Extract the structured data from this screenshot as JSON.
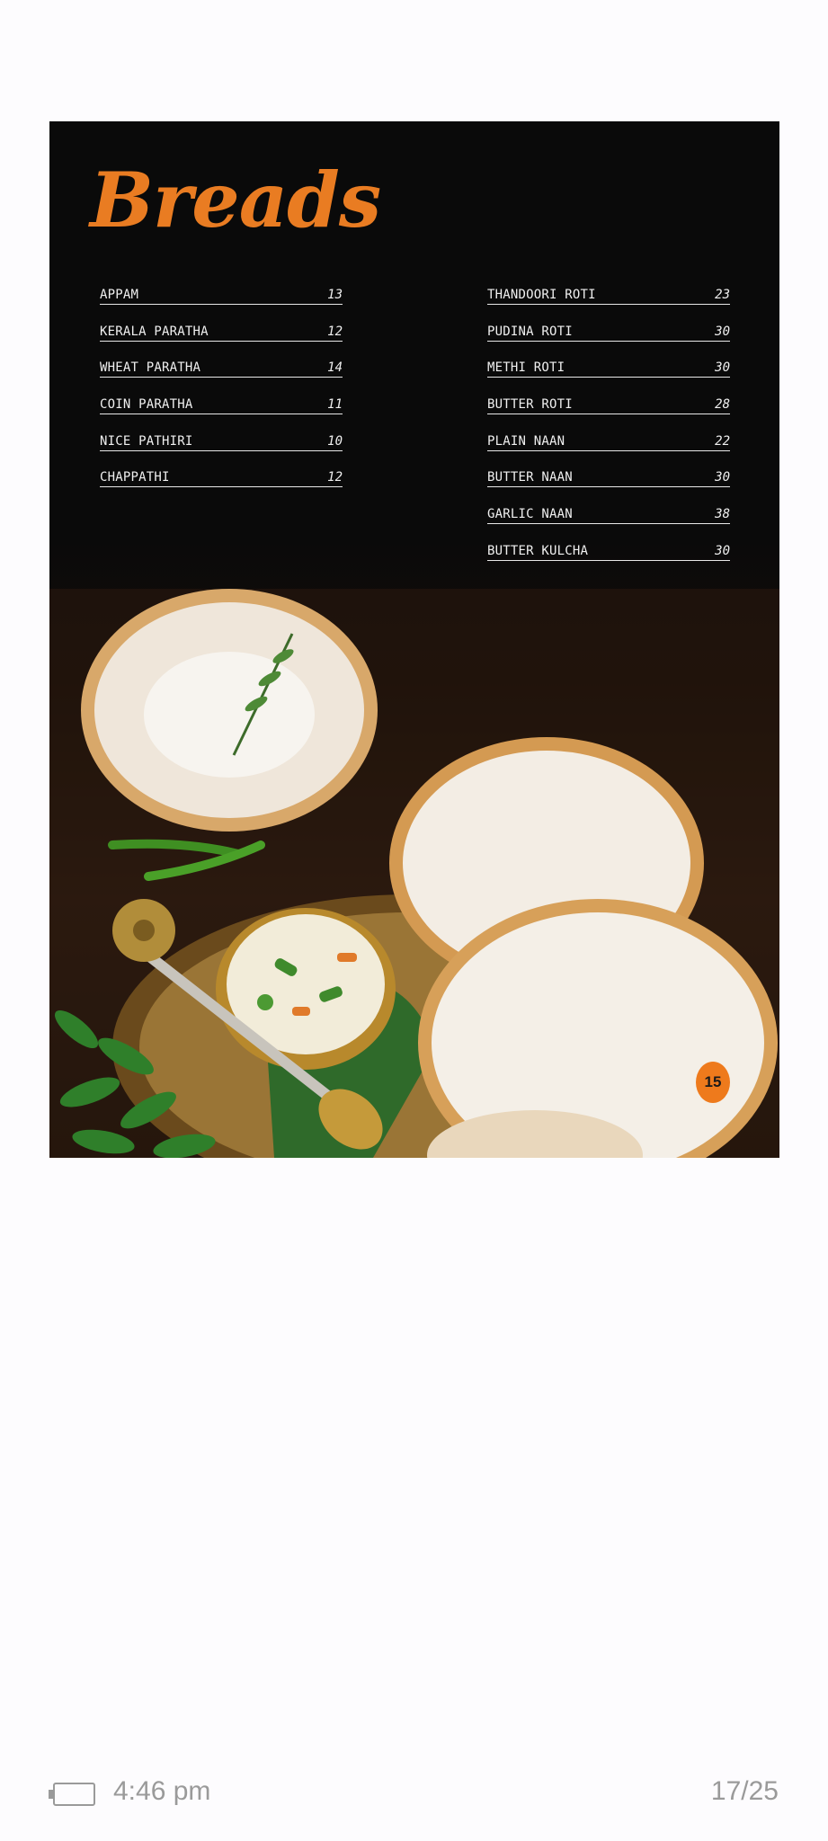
{
  "menu": {
    "title": "Breads",
    "left_items": [
      {
        "name": "APPAM",
        "price": "13"
      },
      {
        "name": "KERALA PARATHA",
        "price": "12"
      },
      {
        "name": "WHEAT PARATHA",
        "price": "14"
      },
      {
        "name": "COIN PARATHA",
        "price": "11"
      },
      {
        "name": "NICE PATHIRI",
        "price": "10"
      },
      {
        "name": "CHAPPATHI",
        "price": "12"
      }
    ],
    "right_items": [
      {
        "name": "THANDOORI ROTI",
        "price": "23"
      },
      {
        "name": "PUDINA ROTI",
        "price": "30"
      },
      {
        "name": "METHI ROTI",
        "price": "30"
      },
      {
        "name": "BUTTER ROTI",
        "price": "28"
      },
      {
        "name": "PLAIN NAAN",
        "price": "22"
      },
      {
        "name": "BUTTER NAAN",
        "price": "30"
      },
      {
        "name": "GARLIC NAAN",
        "price": "38"
      },
      {
        "name": "BUTTER KULCHA",
        "price": "30"
      }
    ],
    "page_number": "15",
    "accent_color": "#e97c22"
  },
  "status_bar": {
    "time": "4:46 pm",
    "page_indicator": "17/25",
    "battery_icon": "battery-icon"
  }
}
